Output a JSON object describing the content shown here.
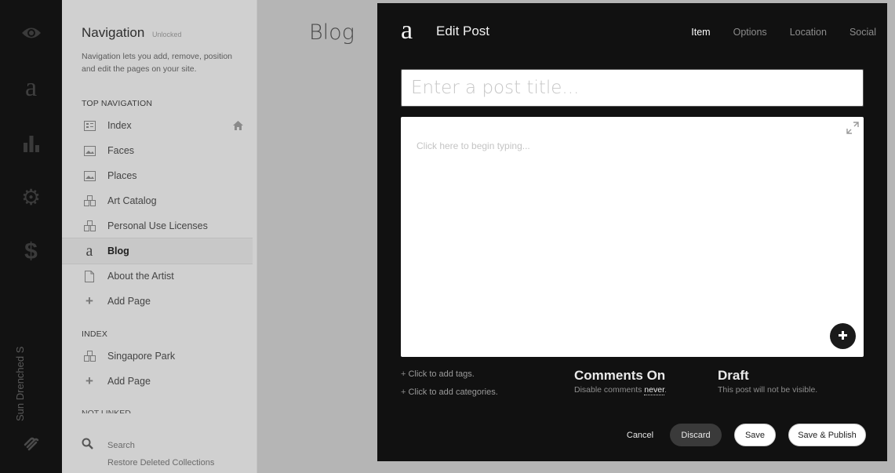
{
  "rail": {
    "icons": [
      "eye-icon",
      "squarespace-a-icon",
      "bar-chart-icon",
      "gear-icon",
      "dollar-icon",
      "squarespace-logo-icon"
    ],
    "site_name": "Sun Drenched S"
  },
  "nav": {
    "title": "Navigation",
    "unlock_label": "Unlocked",
    "description": "Navigation lets you add, remove, position and edit the pages on your site.",
    "top_navigation": {
      "heading": "TOP NAVIGATION",
      "items": [
        {
          "label": "Index",
          "icon": "index-icon"
        },
        {
          "label": "Faces",
          "icon": "gallery-icon"
        },
        {
          "label": "Places",
          "icon": "gallery-icon"
        },
        {
          "label": "Art Catalog",
          "icon": "products-icon"
        },
        {
          "label": "Personal Use Licenses",
          "icon": "products-icon"
        },
        {
          "label": "Blog",
          "icon": "blog-icon",
          "active": true
        },
        {
          "label": "About the Artist",
          "icon": "page-icon"
        },
        {
          "label": "Add Page",
          "icon": "plus-icon"
        }
      ]
    },
    "index_section": {
      "heading": "INDEX",
      "items": [
        {
          "label": "Singapore Park",
          "icon": "products-icon"
        },
        {
          "label": "Add Page",
          "icon": "plus-icon"
        }
      ]
    },
    "not_linked_heading": "NOT LINKED",
    "search_label": "Search",
    "restore_label": "Restore Deleted Collections"
  },
  "page": {
    "heading": "Blog"
  },
  "modal": {
    "title": "Edit Post",
    "tabs": [
      {
        "label": "Item",
        "active": true
      },
      {
        "label": "Options"
      },
      {
        "label": "Location"
      },
      {
        "label": "Social"
      }
    ],
    "title_placeholder": "Enter a post title...",
    "body_placeholder": "Click here to begin typing...",
    "tags_link": "Click to add tags.",
    "categories_link": "Click to add categories.",
    "comments": {
      "heading": "Comments On",
      "sub_prefix": "Disable comments",
      "sub_link": "never",
      "sub_suffix": "."
    },
    "status": {
      "heading": "Draft",
      "sub": "This post will not be visible."
    },
    "buttons": {
      "cancel": "Cancel",
      "discard": "Discard",
      "save": "Save",
      "save_publish": "Save & Publish"
    }
  }
}
